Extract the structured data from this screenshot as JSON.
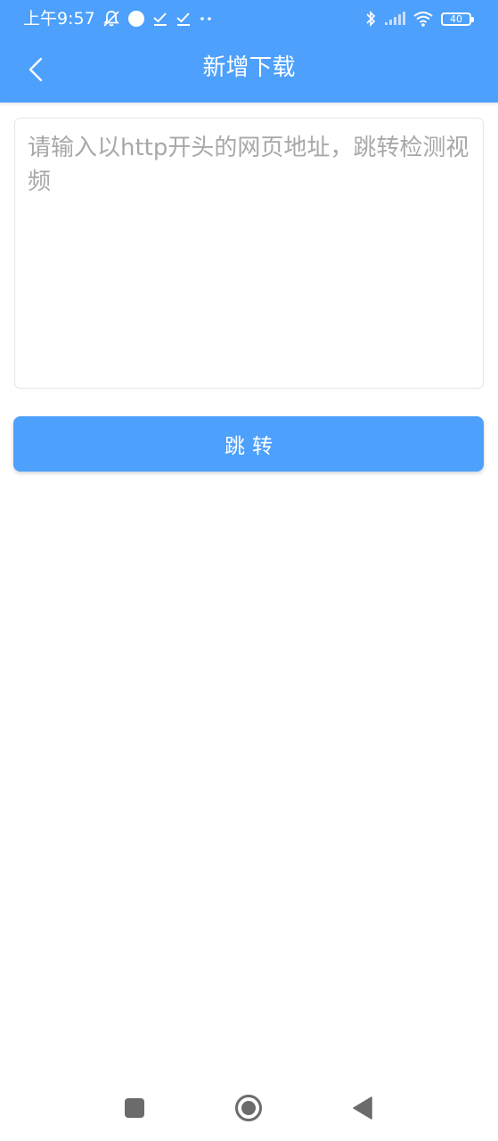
{
  "status_bar": {
    "time": "上午9:57",
    "battery_level": "40",
    "icons_left": [
      "mute-bell-icon",
      "circle-dot-icon",
      "download-check-icon",
      "download-check-icon",
      "more-dots-icon"
    ],
    "icons_right": [
      "bluetooth-icon",
      "signal-icon",
      "wifi-icon",
      "battery-icon"
    ]
  },
  "app_bar": {
    "title": "新增下载",
    "back_icon": "chevron-left-icon"
  },
  "url_input": {
    "value": "",
    "placeholder": "请输入以http开头的网页地址，跳转检测视频"
  },
  "jump_button": {
    "label": "跳转"
  },
  "nav_bar": {
    "items": [
      "recents-square-icon",
      "home-circle-icon",
      "back-triangle-icon"
    ]
  },
  "colors": {
    "primary": "#4da0fc",
    "placeholder": "#a8a8a8",
    "border": "#e6e6e6",
    "nav_icon": "#6b6b6b"
  }
}
